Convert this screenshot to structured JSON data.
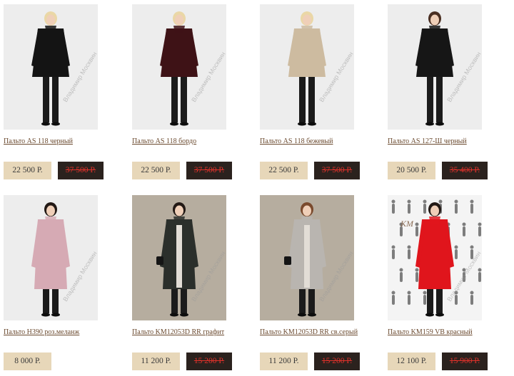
{
  "watermark": "Владимир Москвин",
  "brand_mark": "КМ",
  "products": [
    {
      "title": "Пальто AS 118 черный",
      "price": "22 500 Р.",
      "old_price": "37 500 Р.",
      "bg": "#ededed",
      "coat": "#141414",
      "hair": "#ead7a6",
      "variant": "short"
    },
    {
      "title": "Пальто AS 118 бордо",
      "price": "22 500 Р.",
      "old_price": "37 500 Р.",
      "bg": "#ededed",
      "coat": "#3e1216",
      "hair": "#ead7a6",
      "variant": "short"
    },
    {
      "title": "Пальто AS 118 бежевый",
      "price": "22 500 Р.",
      "old_price": "37 500 Р.",
      "bg": "#ededed",
      "coat": "#cdbba0",
      "hair": "#ead7a6",
      "variant": "short"
    },
    {
      "title": "Пальто AS 127-Ш черный",
      "price": "20 500 Р.",
      "old_price": "35 400 Р.",
      "bg": "#ededed",
      "coat": "#161616",
      "hair": "#4a2f22",
      "variant": "short"
    },
    {
      "title": "Пальто Н390 роз.меланж",
      "price": "8 000 Р.",
      "old_price": "",
      "bg": "#ededed",
      "coat": "#d6aab4",
      "hair": "#221915",
      "variant": "long"
    },
    {
      "title": "Пальто KM12053D RR графит",
      "price": "11 200 Р.",
      "old_price": "15 200 Р.",
      "bg": "#b6ad9f",
      "coat": "#2b2f2b",
      "hair": "#221915",
      "variant": "long-inset"
    },
    {
      "title": "Пальто KM12053D RR св.серый",
      "price": "11 200 Р.",
      "old_price": "15 200 Р.",
      "bg": "#b6ad9f",
      "coat": "#b9b5b0",
      "hair": "#7a4a2d",
      "variant": "long-inset"
    },
    {
      "title": "Пальто KM159 VB красный",
      "price": "12 100 Р.",
      "old_price": "15 900 Р.",
      "bg": "#f4f4f4",
      "coat": "#e0151c",
      "hair": "#221915",
      "variant": "long-pattern"
    }
  ]
}
